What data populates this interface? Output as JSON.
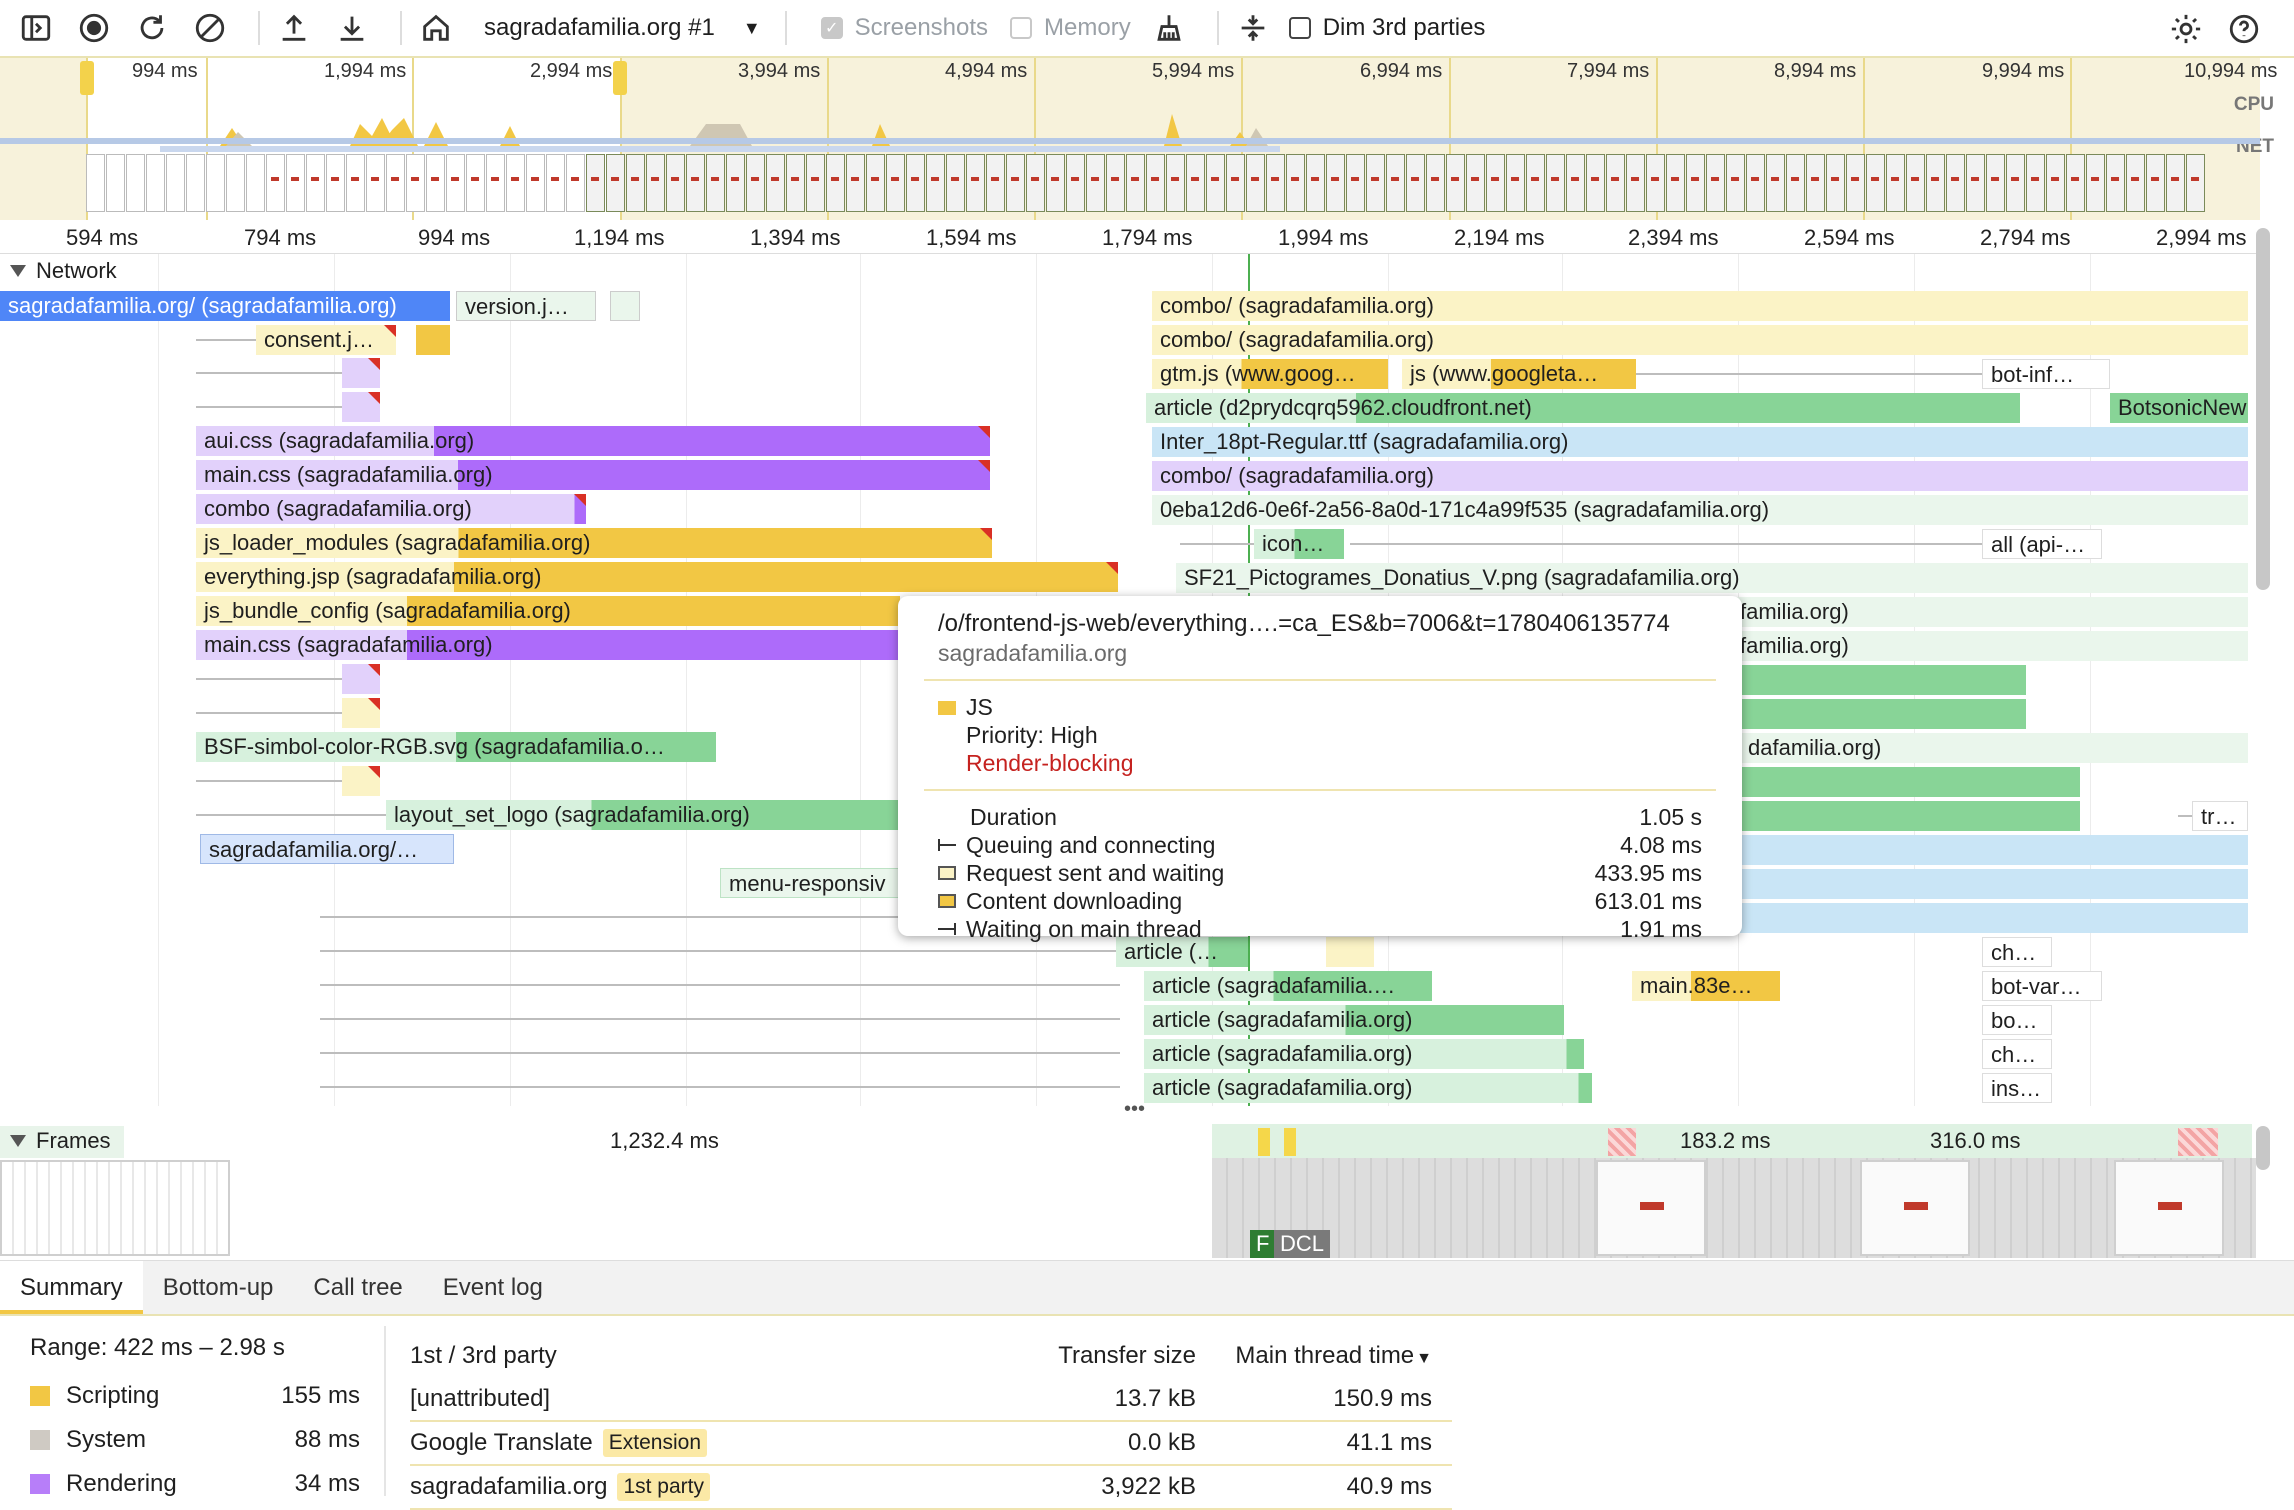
{
  "toolbar": {
    "profile_select": "sagradafamilia.org #1",
    "screenshots_label": "Screenshots",
    "memory_label": "Memory",
    "dim_label": "Dim 3rd parties"
  },
  "overview": {
    "ticks": [
      "994 ms",
      "1,994 ms",
      "2,994 ms",
      "3,994 ms",
      "4,994 ms",
      "5,994 ms",
      "6,994 ms",
      "7,994 ms",
      "8,994 ms",
      "9,994 ms",
      "10,994 ms"
    ],
    "cpu_label": "CPU",
    "net_label": "NET"
  },
  "ruler": {
    "ticks": [
      "594 ms",
      "794 ms",
      "994 ms",
      "1,194 ms",
      "1,394 ms",
      "1,594 ms",
      "1,794 ms",
      "1,994 ms",
      "2,194 ms",
      "2,394 ms",
      "2,594 ms",
      "2,794 ms",
      "2,994 ms"
    ]
  },
  "network": {
    "title": "Network",
    "rows": {
      "r1": "sagradafamilia.org/ (sagradafamilia.org)",
      "r2": "version.j…",
      "r3": "consent.j…",
      "r4": "aui.css (sagradafamilia.org)",
      "r5": "main.css (sagradafamilia.org)",
      "r6": "combo (sagradafamilia.org)",
      "r7": "js_loader_modules (sagradafamilia.org)",
      "r8": "everything.jsp (sagradafamilia.org)",
      "r9": "js_bundle_config (sagradafamilia.org)",
      "r10": "main.css (sagradafamilia.org)",
      "r11": "BSF-simbol-color-RGB.svg (sagradafamilia.o…",
      "r12": "layout_set_logo (sagradafamilia.org)",
      "r13": "sagradafamilia.org/…",
      "r14": "menu-responsiv",
      "m1": "combo/ (sagradafamilia.org)",
      "m2": "combo/ (sagradafamilia.org)",
      "m3": "gtm.js (www.goog…",
      "m4": "js (www.googleta…",
      "m5": "bot-inf…",
      "m6": "article (d2prydcqrq5962.cloudfront.net)",
      "m7": "BotsonicNew",
      "m8": "Inter_18pt-Regular.ttf (sagradafamilia.org)",
      "m9": "combo/ (sagradafamilia.org)",
      "m10": "0eba12d6-0e6f-2a56-8a0d-171c4a99f535 (sagradafamilia.org)",
      "m11": "icon…",
      "m12": "all (api-…",
      "m13": "SF21_Pictogrames_Donatius_V.png (sagradafamilia.org)",
      "m14": "familia.org)",
      "m15": "familia.org)",
      "m16": "dafamilia.org)",
      "m17": "tr…",
      "m18": "article (…",
      "m19": "ch…",
      "m20": "article (sagradafamilia.…",
      "m21": "main.83e…",
      "m22": "bot-var…",
      "m23": "article (sagradafamilia.org)",
      "m24": "bo…",
      "m25": "article (sagradafamilia.org)",
      "m26": "ch…",
      "m27": "article (sagradafamilia.org)",
      "m28": "ins…"
    }
  },
  "tooltip": {
    "url": "/o/frontend-js-web/everything….=ca_ES&b=7006&t=1780406135774",
    "host": "sagradafamilia.org",
    "type": "JS",
    "priority": "Priority: High",
    "blocking": "Render-blocking",
    "rows": [
      {
        "k": "Duration",
        "v": "1.05 s"
      },
      {
        "k": "Queuing and connecting",
        "v": "4.08 ms"
      },
      {
        "k": "Request sent and waiting",
        "v": "433.95 ms"
      },
      {
        "k": "Content downloading",
        "v": "613.01 ms"
      },
      {
        "k": "Waiting on main thread",
        "v": "1.91 ms"
      }
    ]
  },
  "frames": {
    "title": "Frames",
    "f1": "1,232.4 ms",
    "f2": "183.2 ms",
    "f3": "316.0 ms",
    "fcp": "F",
    "dcl": "DCL"
  },
  "tabs": [
    "Summary",
    "Bottom-up",
    "Call tree",
    "Event log"
  ],
  "summary": {
    "range": "Range: 422 ms – 2.98 s",
    "categories": [
      {
        "name": "Scripting",
        "value": "155 ms",
        "color": "#f2c744"
      },
      {
        "name": "System",
        "value": "88 ms",
        "color": "#cfcac3"
      },
      {
        "name": "Rendering",
        "value": "34 ms",
        "color": "#b77ef9"
      }
    ],
    "table": {
      "headers": [
        "1st / 3rd party",
        "Transfer size",
        "Main thread time"
      ],
      "rows": [
        {
          "name": "[unattributed]",
          "badge": "",
          "size": "13.7 kB",
          "time": "150.9 ms"
        },
        {
          "name": "Google Translate",
          "badge": "Extension",
          "size": "0.0 kB",
          "time": "41.1 ms"
        },
        {
          "name": "sagradafamilia.org",
          "badge": "1st party",
          "size": "3,922 kB",
          "time": "40.9 ms"
        }
      ]
    }
  }
}
